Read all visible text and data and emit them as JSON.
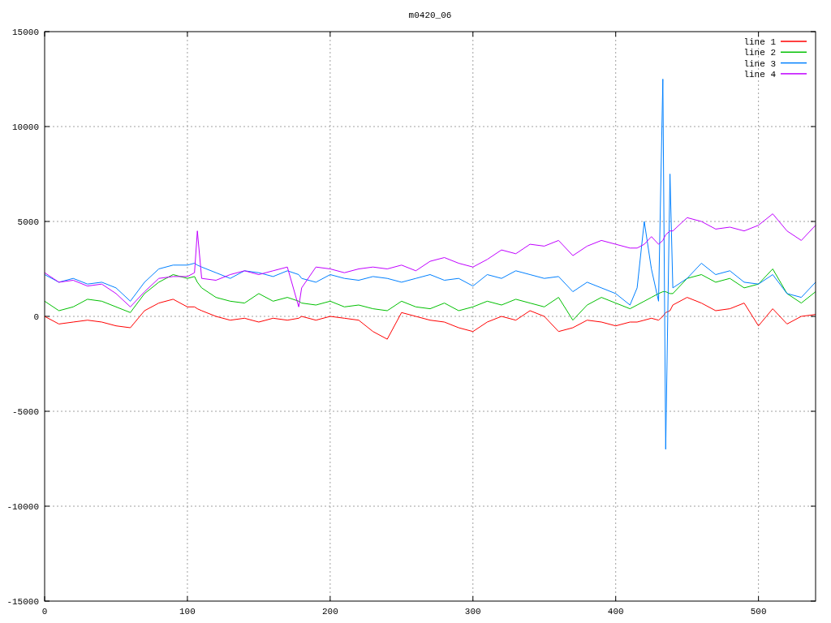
{
  "chart_data": {
    "type": "line",
    "title": "m0420_06",
    "grid": true,
    "legend": true,
    "x": [
      0,
      10,
      20,
      30,
      40,
      50,
      60,
      70,
      80,
      90,
      100,
      105,
      107,
      110,
      120,
      130,
      140,
      150,
      160,
      170,
      178,
      180,
      190,
      200,
      210,
      220,
      230,
      240,
      250,
      260,
      270,
      280,
      290,
      300,
      310,
      320,
      330,
      340,
      350,
      360,
      370,
      380,
      390,
      400,
      410,
      415,
      420,
      425,
      430,
      433,
      435,
      438,
      440,
      450,
      460,
      470,
      480,
      490,
      500,
      510,
      520,
      530,
      540
    ],
    "series": [
      {
        "name": "line 1",
        "color": "#ff0000",
        "values": [
          0,
          -400,
          -300,
          -200,
          -300,
          -500,
          -600,
          300,
          700,
          900,
          500,
          500,
          400,
          300,
          0,
          -200,
          -100,
          -300,
          -100,
          -200,
          -100,
          0,
          -200,
          0,
          -100,
          -200,
          -800,
          -1200,
          200,
          0,
          -200,
          -300,
          -600,
          -800,
          -300,
          0,
          -200,
          300,
          0,
          -800,
          -600,
          -200,
          -300,
          -500,
          -300,
          -300,
          -200,
          -100,
          -200,
          0,
          200,
          300,
          600,
          1000,
          700,
          300,
          400,
          700,
          -500,
          400,
          -400,
          0,
          100
        ]
      },
      {
        "name": "line 2",
        "color": "#00c000",
        "values": [
          800,
          300,
          500,
          900,
          800,
          500,
          200,
          1200,
          1800,
          2200,
          2000,
          2100,
          1800,
          1500,
          1000,
          800,
          700,
          1200,
          800,
          1000,
          800,
          700,
          600,
          800,
          500,
          600,
          400,
          300,
          800,
          500,
          400,
          700,
          300,
          500,
          800,
          600,
          900,
          700,
          500,
          1000,
          -200,
          600,
          1000,
          700,
          400,
          600,
          800,
          1000,
          1200,
          1300,
          1300,
          1200,
          1200,
          2000,
          2200,
          1800,
          2000,
          1500,
          1700,
          2500,
          1200,
          700,
          1300
        ]
      },
      {
        "name": "line 3",
        "color": "#0080ff",
        "values": [
          2200,
          1800,
          2000,
          1700,
          1800,
          1500,
          800,
          1800,
          2500,
          2700,
          2700,
          2800,
          2700,
          2600,
          2300,
          2000,
          2400,
          2300,
          2100,
          2400,
          2200,
          2000,
          1800,
          2200,
          2000,
          1900,
          2100,
          2000,
          1800,
          2000,
          2200,
          1900,
          2000,
          1600,
          2200,
          2000,
          2400,
          2200,
          2000,
          2100,
          1300,
          1800,
          1500,
          1200,
          600,
          1500,
          5000,
          2500,
          800,
          12500,
          -7000,
          7500,
          1500,
          2000,
          2800,
          2200,
          2400,
          1800,
          1700,
          2200,
          1200,
          1000,
          1800
        ]
      },
      {
        "name": "line 4",
        "color": "#c000ff",
        "values": [
          2300,
          1800,
          1900,
          1600,
          1700,
          1200,
          500,
          1300,
          2000,
          2100,
          2100,
          2300,
          4500,
          2000,
          1900,
          2200,
          2400,
          2200,
          2400,
          2600,
          500,
          1500,
          2600,
          2500,
          2300,
          2500,
          2600,
          2500,
          2700,
          2400,
          2900,
          3100,
          2800,
          2600,
          3000,
          3500,
          3300,
          3800,
          3700,
          4000,
          3200,
          3700,
          4000,
          3800,
          3600,
          3600,
          3800,
          4200,
          3800,
          4000,
          4300,
          4500,
          4500,
          5200,
          5000,
          4600,
          4700,
          4500,
          4800,
          5400,
          4500,
          4000,
          4800
        ]
      }
    ],
    "xlim": [
      0,
      540
    ],
    "ylim": [
      -15000,
      15000
    ],
    "xticks": [
      0,
      100,
      200,
      300,
      400,
      500
    ],
    "yticks": [
      -15000,
      -10000,
      -5000,
      0,
      5000,
      10000,
      15000
    ]
  }
}
